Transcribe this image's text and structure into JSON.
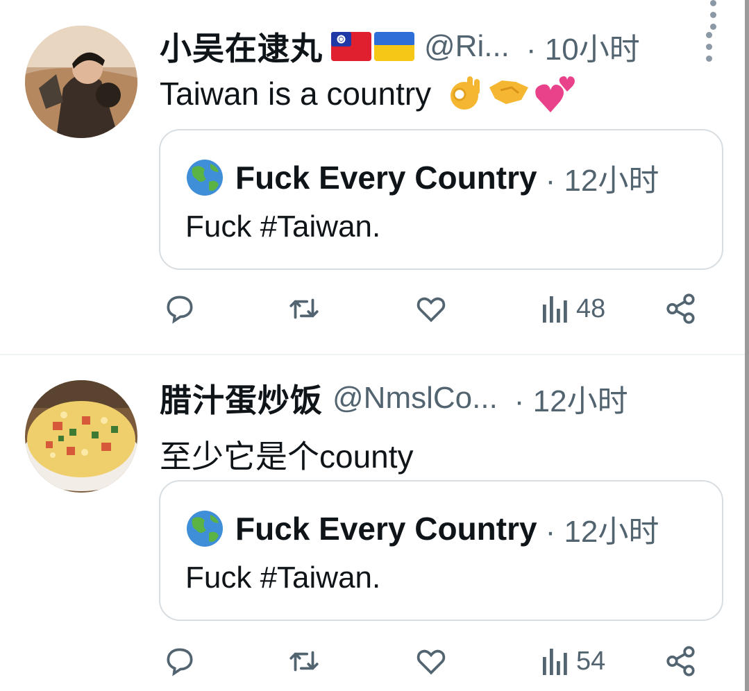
{
  "tweets": [
    {
      "name": "小吴在逮丸",
      "handle": "@Ri...",
      "time": "· 10小时",
      "text": "Taiwan is a country",
      "quote": {
        "name": "Fuck Every Country",
        "time": "· 12小时",
        "text": "Fuck #Taiwan."
      },
      "views": "48"
    },
    {
      "name": "腊汁蛋炒饭",
      "handle": "@NmslCo...",
      "time": "· 12小时",
      "text": "至少它是个county",
      "quote": {
        "name": "Fuck Every Country",
        "time": "· 12小时",
        "text": "Fuck #Taiwan."
      },
      "views": "54"
    }
  ],
  "icons": [
    "taiwan-flag",
    "ukraine-flag",
    "ok-hand",
    "handshake",
    "two-hearts",
    "globe",
    "reply",
    "retweet",
    "like",
    "views",
    "share",
    "more"
  ],
  "colors": {
    "text": "#0f1419",
    "muted": "#536471",
    "border": "#d7dde1"
  }
}
